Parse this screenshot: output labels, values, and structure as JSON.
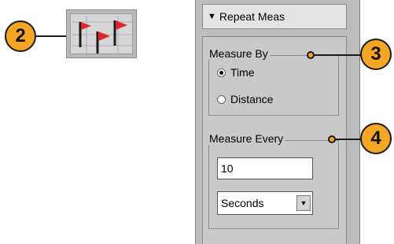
{
  "callouts": {
    "c2": "2",
    "c3": "3",
    "c4": "4"
  },
  "toolbar": {
    "icon": "repeat-measurement-flags-icon"
  },
  "panel": {
    "header_label": "Repeat Meas",
    "measure_by": {
      "title": "Measure By",
      "options": [
        "Time",
        "Distance"
      ],
      "selected": "Time"
    },
    "measure_every": {
      "title": "Measure Every",
      "value": "10",
      "unit_selected": "Seconds"
    }
  },
  "colors": {
    "callout_fill": "#f5a623",
    "flag_red": "#e0262a",
    "panel_bg": "#c9c9c9"
  }
}
